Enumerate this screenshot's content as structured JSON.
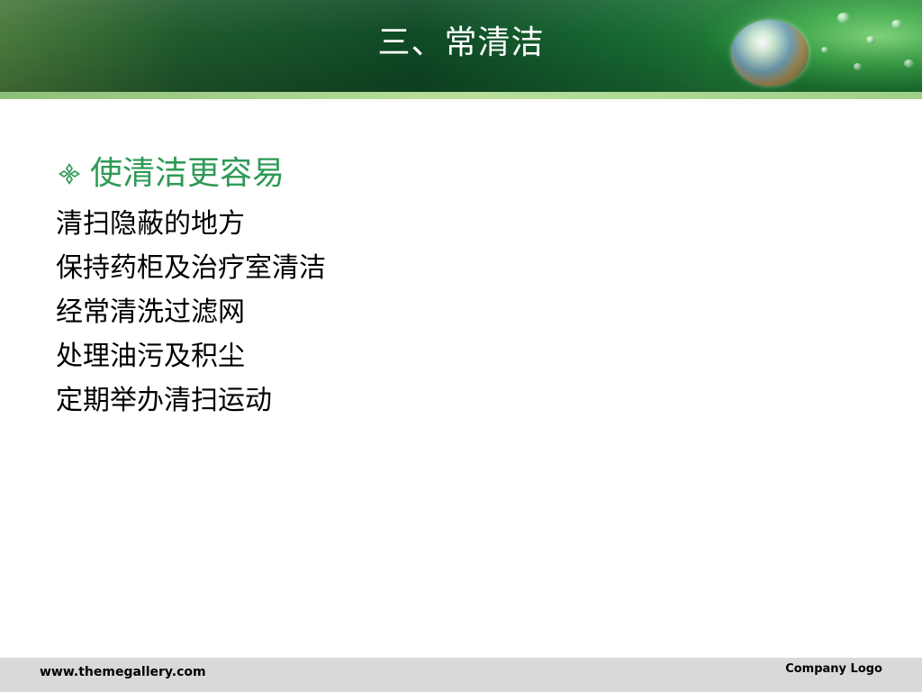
{
  "header": {
    "title": "三、常清洁"
  },
  "content": {
    "heading": "使清洁更容易",
    "heading_color": "#2e9a55",
    "bullet_icon": "diamond-bullet-icon",
    "items": [
      "清扫隐蔽的地方",
      "保持药柜及治疗室清洁",
      "经常清洗过滤网",
      "处理油污及积尘",
      "定期举办清扫运动"
    ]
  },
  "footer": {
    "url": "www.themegallery.com",
    "logo": "Company Logo"
  },
  "colors": {
    "header_green": "#1f5a2c",
    "footer_gray": "#d9d9d9"
  }
}
